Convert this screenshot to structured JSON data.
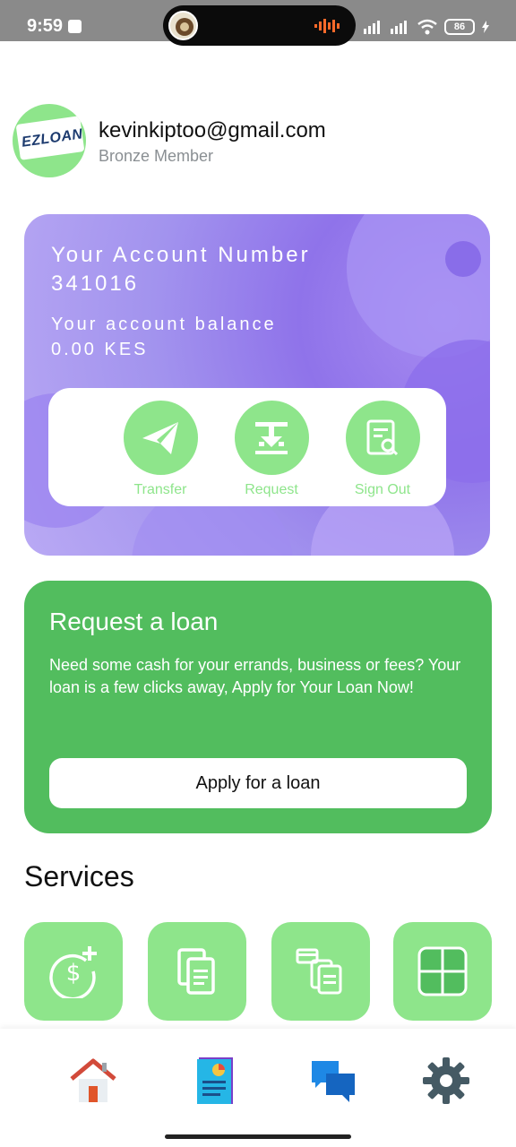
{
  "status_bar": {
    "time": "9:59",
    "battery": "86"
  },
  "profile": {
    "email": "kevinkiptoo@gmail.com",
    "membership": "Bronze Member",
    "logo_text": "EZLOAN"
  },
  "account_card": {
    "account_label": "Your Account Number",
    "account_number": "341016",
    "balance_label": "Your account balance",
    "balance_value": "0.00 KES",
    "actions": [
      {
        "label": "Transfer",
        "icon": "send-icon"
      },
      {
        "label": "Request",
        "icon": "download-icon"
      },
      {
        "label": "Sign Out",
        "icon": "document-search-icon"
      }
    ]
  },
  "loan_card": {
    "title": "Request a loan",
    "description": "Need some cash for your errands, business or fees? Your loan is a few clicks away, Apply for Your Loan Now!",
    "button_label": "Apply for a loan"
  },
  "services": {
    "title": "Services",
    "tiles": [
      {
        "icon": "dollar-add-icon"
      },
      {
        "icon": "documents-icon"
      },
      {
        "icon": "card-documents-icon"
      },
      {
        "icon": "grid-icon"
      }
    ]
  },
  "bottom_nav": {
    "items": [
      {
        "icon": "home-icon"
      },
      {
        "icon": "report-icon"
      },
      {
        "icon": "chat-icon"
      },
      {
        "icon": "settings-icon"
      }
    ]
  },
  "colors": {
    "accent_green": "#8ee58b",
    "loan_green": "#52bd5e",
    "card_purple": "#9a82ee"
  }
}
